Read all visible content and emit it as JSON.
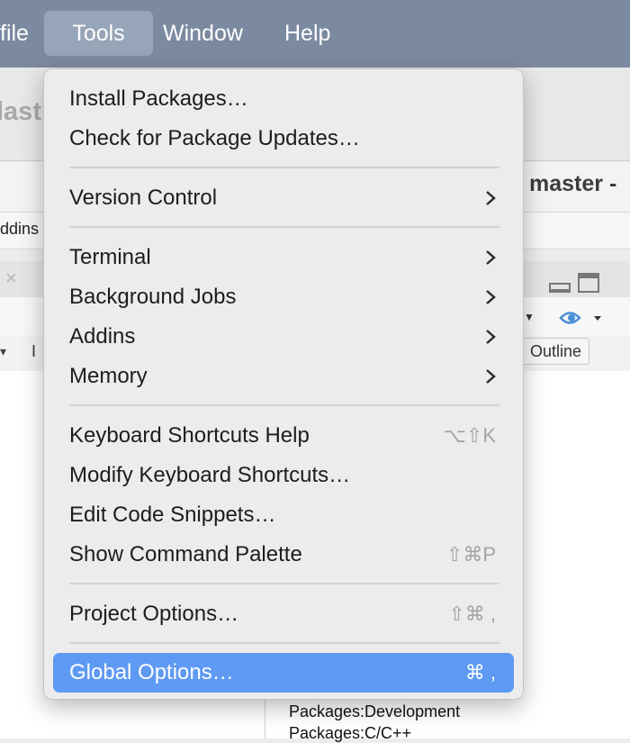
{
  "menubar": {
    "items": [
      {
        "label": "file"
      },
      {
        "label": "Tools"
      },
      {
        "label": "Window"
      },
      {
        "label": "Help"
      }
    ]
  },
  "background": {
    "title_fragment": "last",
    "branch": "master -",
    "addins_label": "ddins",
    "close_glyph": "×",
    "left_dropdown": "▾",
    "left_toolbar_fragment": "I",
    "outline_button": "Outline",
    "packages": [
      "Packages:Development",
      "Packages:C/C++"
    ]
  },
  "menu": {
    "items": [
      {
        "label": "Install Packages…",
        "shortcut": "",
        "submenu": false
      },
      {
        "label": "Check for Package Updates…",
        "shortcut": "",
        "submenu": false
      },
      {
        "label": "Version Control",
        "shortcut": "",
        "submenu": true
      },
      {
        "label": "Terminal",
        "shortcut": "",
        "submenu": true
      },
      {
        "label": "Background Jobs",
        "shortcut": "",
        "submenu": true
      },
      {
        "label": "Addins",
        "shortcut": "",
        "submenu": true
      },
      {
        "label": "Memory",
        "shortcut": "",
        "submenu": true
      },
      {
        "label": "Keyboard Shortcuts Help",
        "shortcut": "⌥⇧K",
        "submenu": false
      },
      {
        "label": "Modify Keyboard Shortcuts…",
        "shortcut": "",
        "submenu": false
      },
      {
        "label": "Edit Code Snippets…",
        "shortcut": "",
        "submenu": false
      },
      {
        "label": "Show Command Palette",
        "shortcut": "⇧⌘P",
        "submenu": false
      },
      {
        "label": "Project Options…",
        "shortcut": "⇧⌘ ,",
        "submenu": false
      },
      {
        "label": "Global Options…",
        "shortcut": "⌘ ,",
        "submenu": false,
        "highlighted": true
      }
    ]
  },
  "colors": {
    "menubar": "#7b8aa0",
    "menubar_active": "#97a5b8",
    "highlight": "#5e9af3",
    "menu_bg": "#ececec"
  }
}
